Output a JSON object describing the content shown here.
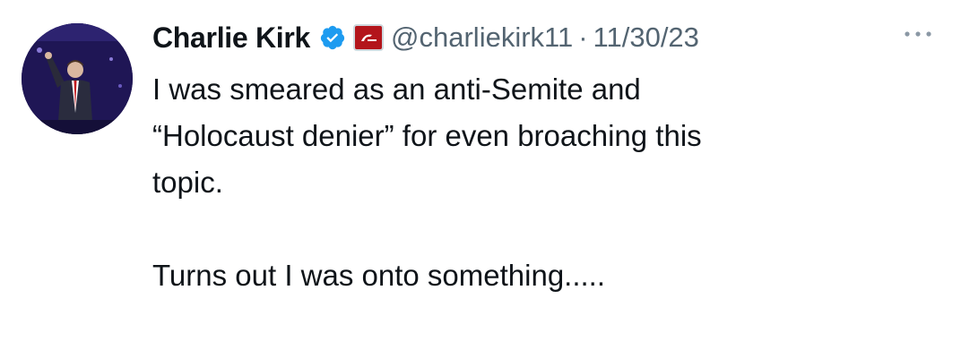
{
  "tweet": {
    "author": {
      "display_name": "Charlie Kirk",
      "handle": "@charliekirk11",
      "verified": true,
      "verified_badge_color": "#1d9bf0",
      "affiliate_badge_color": "#b3151b",
      "avatar_icon": "avatar-photo"
    },
    "separator": "·",
    "date": "11/30/23",
    "more_icon": "more-options-icon",
    "text": "I was smeared as an anti-Semite and\n“Holocaust denier” for even broaching this\ntopic.\n\nTurns out I was onto something....."
  }
}
